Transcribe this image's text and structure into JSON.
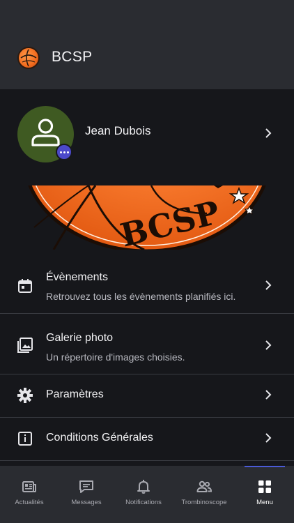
{
  "app": {
    "title": "BCSP",
    "logo_icon": "basketball-club-logo"
  },
  "profile": {
    "name": "Jean Dubois",
    "avatar_icon": "user-icon",
    "badge_icon": "more-dots-icon"
  },
  "banner": {
    "text": "BCSP"
  },
  "menu": [
    {
      "title": "Évènements",
      "subtitle": "Retrouvez tous les évènements planifiés ici.",
      "icon": "calendar-icon"
    },
    {
      "title": "Galerie photo",
      "subtitle": "Un répertoire d'images choisies.",
      "icon": "photo-gallery-icon"
    },
    {
      "title": "Paramètres",
      "icon": "gear-icon"
    },
    {
      "title": "Conditions Générales",
      "icon": "info-icon"
    }
  ],
  "nav": [
    {
      "label": "Actualités",
      "icon": "news-icon"
    },
    {
      "label": "Messages",
      "icon": "chat-icon"
    },
    {
      "label": "Notifications",
      "icon": "bell-icon"
    },
    {
      "label": "Trombinoscope",
      "icon": "people-icon"
    },
    {
      "label": "Menu",
      "icon": "grid-icon",
      "active": true
    }
  ],
  "colors": {
    "accent": "#4b5bd6",
    "avatar_bg": "#3f5a22",
    "badge": "#4b49c9",
    "brand_orange": "#f26b1d"
  }
}
